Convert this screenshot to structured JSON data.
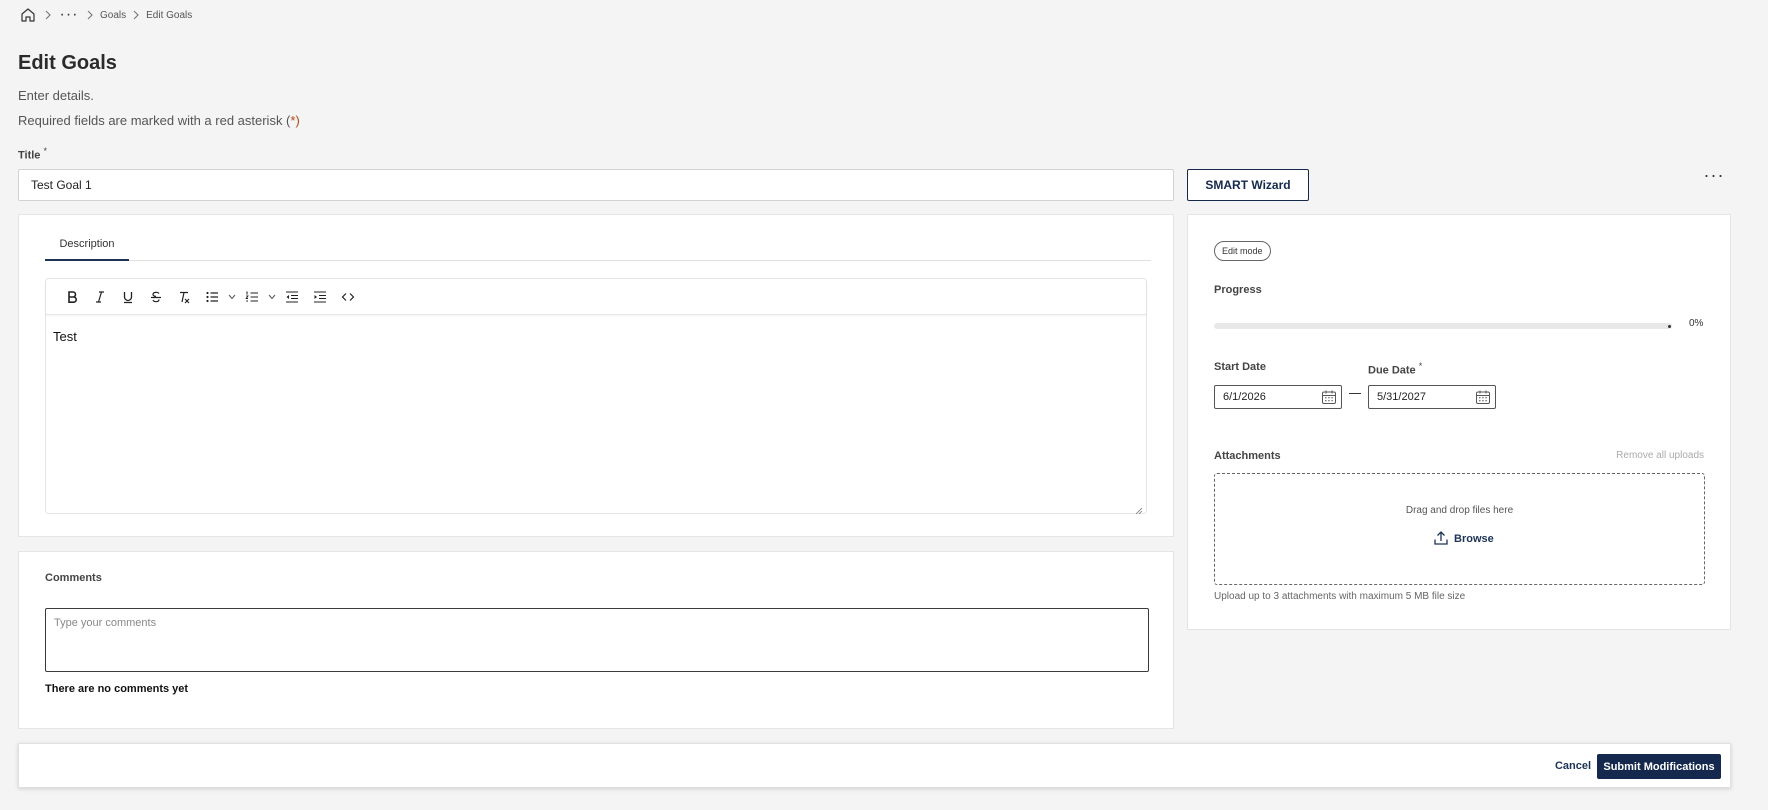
{
  "breadcrumb": {
    "home_icon": "home-icon",
    "more": "···",
    "items": [
      "Goals",
      "Edit Goals"
    ]
  },
  "header": {
    "title": "Edit Goals",
    "subtitle": "Enter details.",
    "required_note_prefix": "Required fields are marked with a red asterisk (",
    "required_note_star": "*",
    "required_note_suffix": ")"
  },
  "title_field": {
    "label": "Title",
    "required_mark": "*",
    "value": "Test Goal 1"
  },
  "smart_wizard": {
    "label": "SMART Wizard"
  },
  "more_menu": {
    "label": "···"
  },
  "description": {
    "tab_label": "Description",
    "toolbar": [
      "bold-icon",
      "italic-icon",
      "underline-icon",
      "strikethrough-icon",
      "clear-format-icon",
      "bullet-list-icon",
      "numbered-list-icon",
      "outdent-icon",
      "indent-icon",
      "code-icon"
    ],
    "content": "Test"
  },
  "comments": {
    "label": "Comments",
    "placeholder": "Type your comments",
    "empty_text": "There are no comments yet"
  },
  "side_panel": {
    "edit_mode_badge": "Edit mode",
    "progress_label": "Progress",
    "progress_value": "0%",
    "progress_fraction": 0,
    "start_date_label": "Start Date",
    "start_date_value": "6/1/2026",
    "due_date_label": "Due Date",
    "due_date_required_mark": "*",
    "due_date_value": "5/31/2027",
    "attachments_label": "Attachments",
    "remove_all_label": "Remove all uploads",
    "drop_text": "Drag and drop files here",
    "browse_label": "Browse",
    "upload_hint": "Upload up to 3 attachments with maximum 5 MB file size"
  },
  "footer": {
    "cancel_label": "Cancel",
    "submit_label": "Submit Modifications"
  },
  "colors": {
    "accent": "#14294d",
    "required": "#b34a16",
    "background": "#f4f4f4"
  }
}
